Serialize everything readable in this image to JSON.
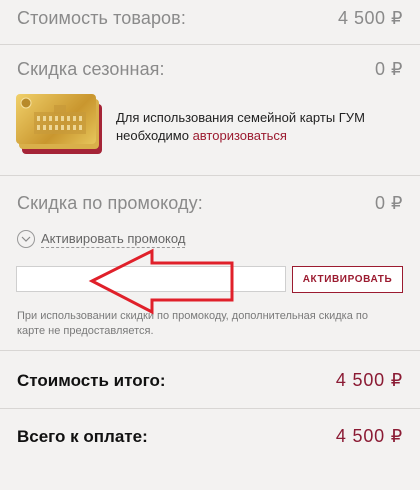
{
  "summary": {
    "goods_cost_label": "Стоимость товаров:",
    "goods_cost_value": "4 500 ₽",
    "seasonal_discount_label": "Скидка сезонная:",
    "seasonal_discount_value": "0 ₽"
  },
  "family_card": {
    "text_line1": "Для использования семейной карты ГУМ",
    "text_prefix": "необходимо ",
    "authorize_link": "авторизоваться"
  },
  "promo": {
    "discount_label": "Скидка по промокоду:",
    "discount_value": "0 ₽",
    "toggle_label": "Активировать промокод",
    "input_value": "",
    "input_placeholder": "",
    "activate_button": "АКТИВИРОВАТЬ",
    "note": "При использовании скидки по промокоду, дополнительная скидка по карте не предоставляется."
  },
  "totals": {
    "total_cost_label": "Стоимость итого:",
    "total_cost_value": "4 500 ₽",
    "to_pay_label": "Всего к оплате:",
    "to_pay_value": "4 500 ₽"
  },
  "colors": {
    "accent": "#9b1b30",
    "annotation_arrow": "#e0202a",
    "background": "#f3f2f1"
  },
  "icons": {
    "toggle": "chevron-down-icon",
    "card": "gum-family-card-image",
    "annotation": "red-arrow-pointing-left"
  }
}
